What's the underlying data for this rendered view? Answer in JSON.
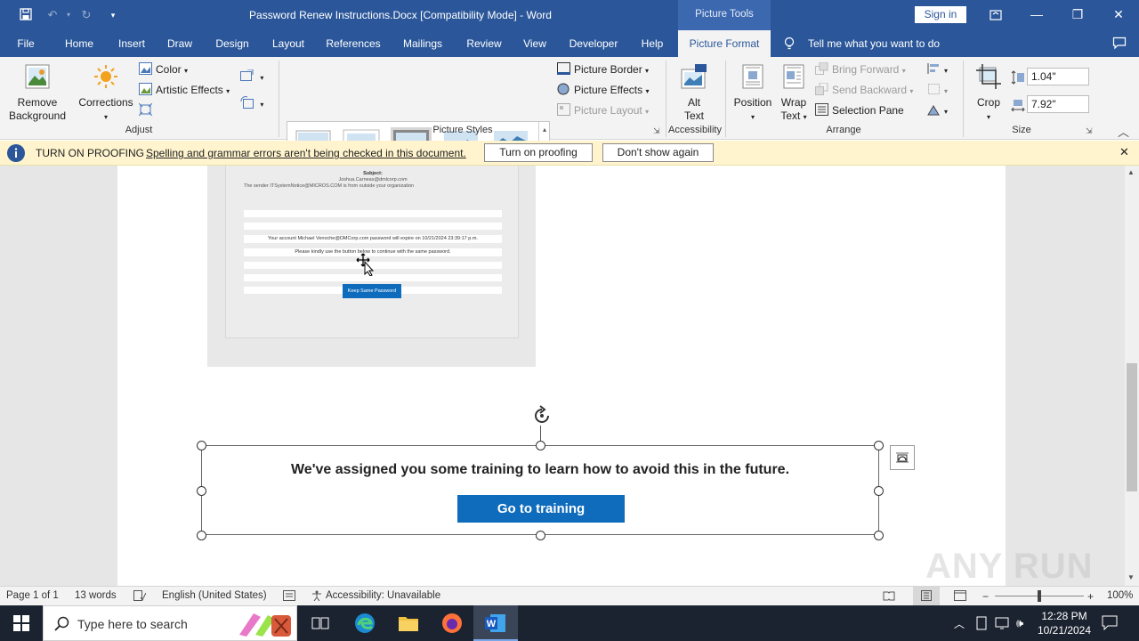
{
  "titlebar": {
    "doc_title": "Password Renew Instructions.Docx [Compatibility Mode] - Word",
    "picture_tools": "Picture Tools",
    "sign_in": "Sign in"
  },
  "tabs": [
    "File",
    "Home",
    "Insert",
    "Draw",
    "Design",
    "Layout",
    "References",
    "Mailings",
    "Review",
    "View",
    "Developer",
    "Help",
    "Picture Format"
  ],
  "tell_me": "Tell me what you want to do",
  "ribbon": {
    "remove_bg_1": "Remove",
    "remove_bg_2": "Background",
    "corrections": "Corrections",
    "color": "Color",
    "artistic": "Artistic Effects",
    "adjust": "Adjust",
    "picture_styles": "Picture Styles",
    "picture_border": "Picture Border",
    "picture_effects": "Picture Effects",
    "picture_layout": "Picture Layout",
    "alt_1": "Alt",
    "alt_2": "Text",
    "accessibility": "Accessibility",
    "position": "Position",
    "wrap_1": "Wrap",
    "wrap_2": "Text",
    "bring_forward": "Bring Forward",
    "send_backward": "Send Backward",
    "selection_pane": "Selection Pane",
    "arrange": "Arrange",
    "crop": "Crop",
    "height": "1.04\"",
    "width": "7.92\"",
    "size": "Size"
  },
  "message_bar": {
    "title": "TURN ON PROOFING",
    "text": "Spelling and grammar errors aren't being checked in this document.",
    "btn_turn_on": "Turn on proofing",
    "btn_dont_show": "Don't show again"
  },
  "embedded_email": {
    "subject_label": "Subject:",
    "from_addr": "Joshua.Carneas@dmlcorp.com",
    "warning": "The sender ITSystemNotice@MICROS.COM is from outside your organization",
    "line1": "Your account Michael Venoche@DMCorp.com password will expire on 10/21/2024 23:39:17 p.m.",
    "line2": "Please kindly use the button below to continue with the same password.",
    "button": "Keep Same Password"
  },
  "training": {
    "heading": "We've assigned you some training to learn how to avoid this in the future.",
    "button": "Go to training"
  },
  "status": {
    "page": "Page 1 of 1",
    "words": "13 words",
    "language": "English (United States)",
    "accessibility": "Accessibility: Unavailable",
    "zoom": "100%"
  },
  "taskbar": {
    "search_placeholder": "Type here to search",
    "time": "12:28 PM",
    "date": "10/21/2024"
  },
  "watermark": "ANY RUN",
  "colors": {
    "word_blue": "#2b579a",
    "training_button": "#0f6cbd",
    "message_bar": "#fff4ce"
  }
}
